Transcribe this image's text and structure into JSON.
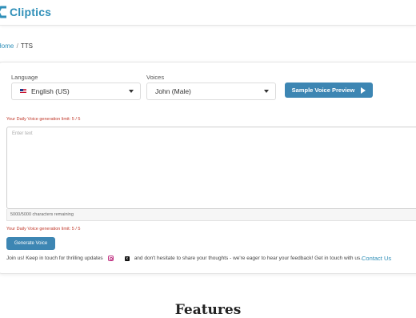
{
  "brand": {
    "name": "Cliptics",
    "color": "#2f8fb8"
  },
  "breadcrumb": {
    "home": "Home",
    "separator": "/",
    "current": "TTS"
  },
  "language": {
    "label": "Language",
    "value": "English (US)",
    "flag_icon": "us-flag-icon"
  },
  "voices": {
    "label": "Voices",
    "value": "John (Male)"
  },
  "preview_button": {
    "label": "Sample Voice Preview",
    "icon": "play-icon"
  },
  "limit_text": "Your Daily Voice generation limit: 5 / 5",
  "text_input": {
    "placeholder": "Enter text",
    "counter": "5000/5000 characters remaining"
  },
  "generate_button": {
    "label": "Generate Voice"
  },
  "footer": {
    "join_text": "Join us! Keep in touch for thrilling updates",
    "mid_text": "and don't hesitate to share your thoughts - we're eager to hear your feedback! Get in touch with us.",
    "contact_link": "Contact Us",
    "icons": [
      "instagram-icon",
      "x-icon"
    ]
  },
  "features_heading": "Features",
  "colors": {
    "accent": "#3d86b3",
    "error": "#c0392b"
  }
}
